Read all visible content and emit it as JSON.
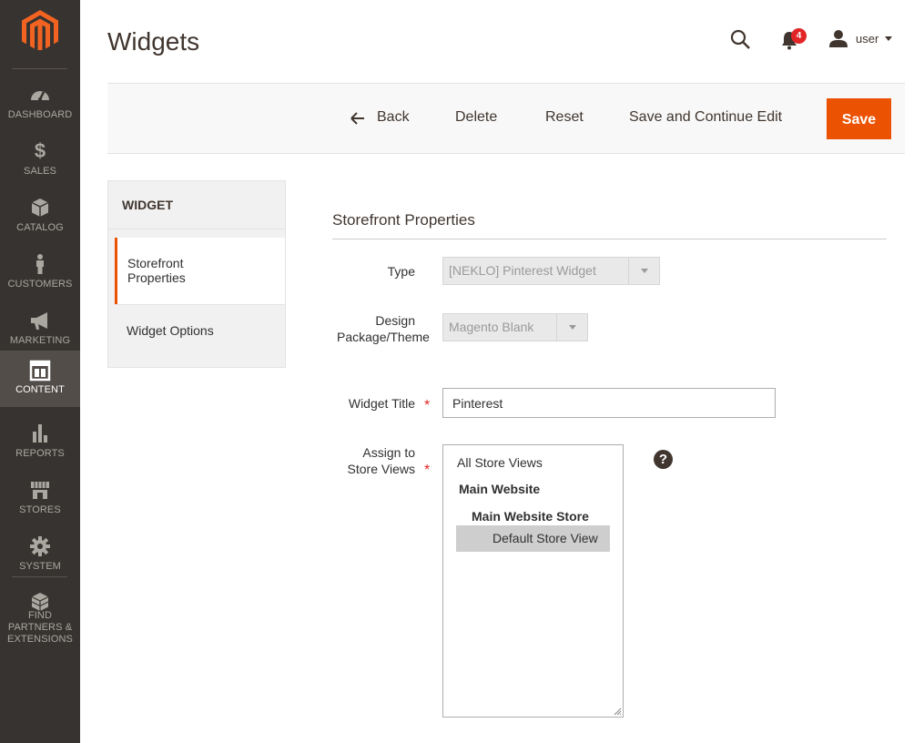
{
  "sidebar": {
    "items": [
      {
        "label": "DASHBOARD",
        "icon": "dashboard-icon"
      },
      {
        "label": "SALES",
        "icon": "dollar-icon"
      },
      {
        "label": "CATALOG",
        "icon": "box-icon"
      },
      {
        "label": "CUSTOMERS",
        "icon": "person-icon"
      },
      {
        "label": "MARKETING",
        "icon": "megaphone-icon"
      },
      {
        "label": "CONTENT",
        "icon": "layout-icon",
        "active": true
      },
      {
        "label": "REPORTS",
        "icon": "bar-chart-icon"
      },
      {
        "label": "STORES",
        "icon": "storefront-icon"
      },
      {
        "label": "SYSTEM",
        "icon": "gear-icon"
      },
      {
        "label": "FIND PARTNERS & EXTENSIONS",
        "icon": "cubes-icon"
      }
    ]
  },
  "header": {
    "title": "Widgets",
    "notification_count": "4",
    "user_name": "user"
  },
  "actions": {
    "back": "Back",
    "delete": "Delete",
    "reset": "Reset",
    "save_continue": "Save and Continue Edit",
    "save": "Save"
  },
  "tabs": {
    "title": "WIDGET",
    "items": [
      "Storefront Properties",
      "Widget Options"
    ]
  },
  "form": {
    "section_title": "Storefront Properties",
    "type_label": "Type",
    "type_value": "[NEKLO] Pinterest Widget",
    "theme_label": "Design Package/Theme",
    "theme_value": "Magento Blank",
    "title_label": "Widget Title",
    "title_value": "Pinterest",
    "stores_label": "Assign to Store Views",
    "store_options": {
      "all": "All Store Views",
      "website": "Main Website",
      "store": "Main Website Store",
      "view": "Default Store View"
    },
    "help": "?"
  },
  "colors": {
    "sidebar_bg": "#373330",
    "accent": "#eb5202",
    "required": "#e22626"
  }
}
